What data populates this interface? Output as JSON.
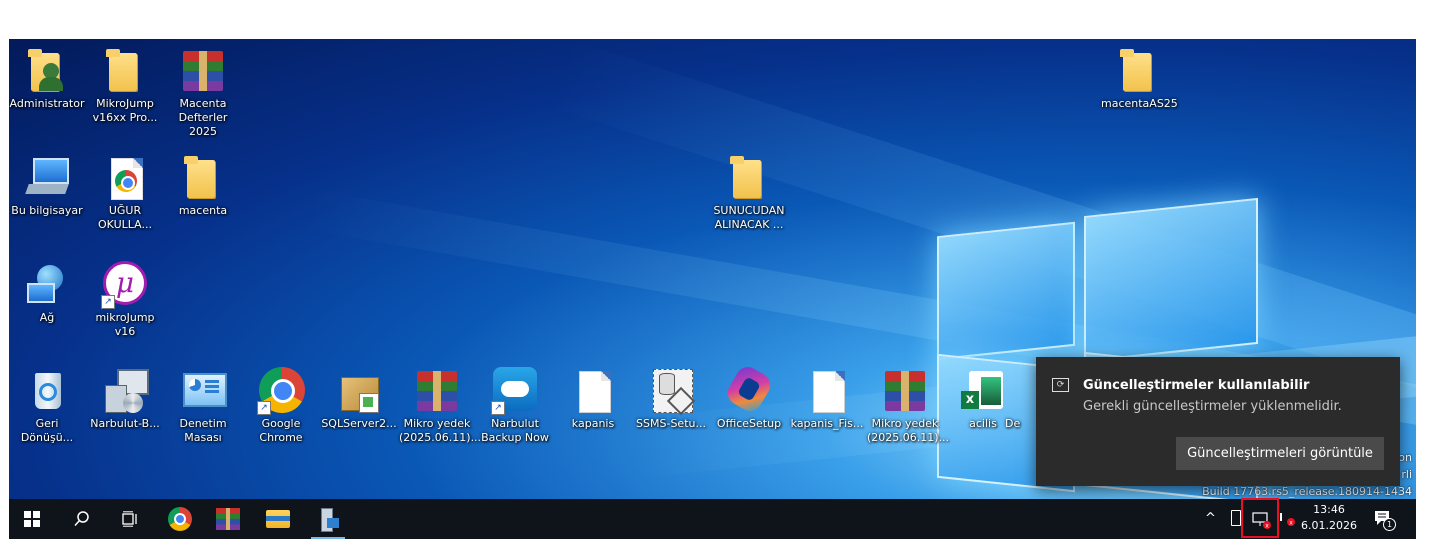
{
  "desktop": {
    "icons": [
      {
        "label": "Administrator",
        "icon": "user-folder-icon"
      },
      {
        "label": "MikroJump\nv16xx Pro...",
        "icon": "folder-icon"
      },
      {
        "label": "Macenta\nDefterler 2025",
        "icon": "winrar-icon"
      },
      {
        "label": "Bu bilgisayar",
        "icon": "computer-icon"
      },
      {
        "label": "UĞUR\nOKULLA...",
        "icon": "chrome-file-icon"
      },
      {
        "label": "macenta",
        "icon": "folder-icon"
      },
      {
        "label": "Ağ",
        "icon": "network-icon"
      },
      {
        "label": "mikroJump\nv16",
        "icon": "mikro-icon"
      },
      {
        "label": "SUNUCUDAN\nALINACAK ...",
        "icon": "folder-icon"
      },
      {
        "label": "macentaAS25",
        "icon": "folder-icon"
      },
      {
        "label": "Geri\nDönüşü...",
        "icon": "recycle-bin-icon"
      },
      {
        "label": "Narbulut-B...",
        "icon": "installer-icon"
      },
      {
        "label": "Denetim\nMasası",
        "icon": "control-panel-icon"
      },
      {
        "label": "Google\nChrome",
        "icon": "chrome-icon"
      },
      {
        "label": "SQLServer2...",
        "icon": "package-icon"
      },
      {
        "label": "Mikro yedek\n(2025.06.11)...",
        "icon": "winrar-icon"
      },
      {
        "label": "Narbulut\nBackup Now",
        "icon": "cloud-backup-icon"
      },
      {
        "label": "kapanis",
        "icon": "file-icon"
      },
      {
        "label": "SSMS-Setu...",
        "icon": "ssms-icon"
      },
      {
        "label": "OfficeSetup",
        "icon": "office-icon"
      },
      {
        "label": "kapanis_Fis...",
        "icon": "file-icon"
      },
      {
        "label": "Mikro yedek\n(2025.06.11)...",
        "icon": "winrar-icon"
      },
      {
        "label": "acilis",
        "icon": "excel-icon"
      },
      {
        "label": "De",
        "icon": "file-icon"
      }
    ],
    "watermark": {
      "line1": "on",
      "line2": "rli",
      "line3": "Build 17763.rs5_release.180914-1434"
    }
  },
  "notification": {
    "title": "Güncelleştirmeler kullanılabilir",
    "body": "Gerekli güncelleştirmeler yüklenmelidir.",
    "button": "Güncelleştirmeleri görüntüle",
    "icon": "update-icon"
  },
  "taskbar": {
    "buttons": [
      "start-icon",
      "search-icon",
      "task-view-icon",
      "chrome-icon",
      "winrar-icon",
      "file-explorer-icon",
      "server-manager-icon"
    ],
    "tray": {
      "time": "13:46",
      "date": "6.01.2026",
      "notification_count": "1",
      "chevron": "^"
    }
  },
  "colors": {
    "taskbar": "#0f131a",
    "toast": "#2b2b2b",
    "highlight_box": "#e81123",
    "active_indicator": "#76b9ed"
  }
}
